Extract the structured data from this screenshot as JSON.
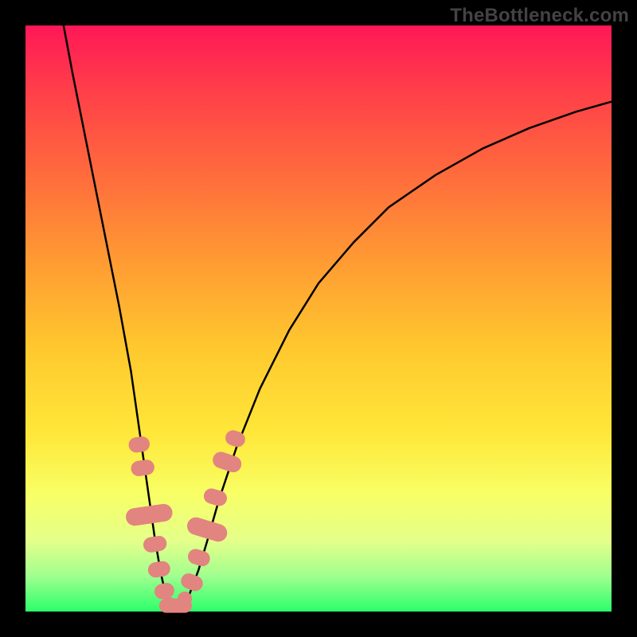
{
  "watermark": "TheBottleneck.com",
  "colors": {
    "curve_stroke": "#000000",
    "marker_fill": "#e2847f",
    "marker_stroke": "#e2847f"
  },
  "chart_data": {
    "type": "line",
    "title": "",
    "xlabel": "",
    "ylabel": "",
    "xlim": [
      0,
      100
    ],
    "ylim": [
      0,
      100
    ],
    "curve_points": [
      {
        "x": 6.5,
        "y": 100
      },
      {
        "x": 8.0,
        "y": 92
      },
      {
        "x": 10.0,
        "y": 82
      },
      {
        "x": 12.0,
        "y": 72
      },
      {
        "x": 14.0,
        "y": 62
      },
      {
        "x": 16.0,
        "y": 52
      },
      {
        "x": 18.0,
        "y": 41
      },
      {
        "x": 19.0,
        "y": 34
      },
      {
        "x": 20.0,
        "y": 27
      },
      {
        "x": 21.0,
        "y": 20
      },
      {
        "x": 22.0,
        "y": 13
      },
      {
        "x": 23.0,
        "y": 7
      },
      {
        "x": 24.0,
        "y": 2.5
      },
      {
        "x": 25.0,
        "y": 0.7
      },
      {
        "x": 26.5,
        "y": 0.7
      },
      {
        "x": 28.0,
        "y": 3
      },
      {
        "x": 29.5,
        "y": 7
      },
      {
        "x": 31.0,
        "y": 12
      },
      {
        "x": 33.0,
        "y": 19
      },
      {
        "x": 36.0,
        "y": 28
      },
      {
        "x": 40.0,
        "y": 38
      },
      {
        "x": 45.0,
        "y": 48
      },
      {
        "x": 50.0,
        "y": 56
      },
      {
        "x": 56.0,
        "y": 63
      },
      {
        "x": 62.0,
        "y": 69
      },
      {
        "x": 70.0,
        "y": 74.5
      },
      {
        "x": 78.0,
        "y": 79
      },
      {
        "x": 86.0,
        "y": 82.5
      },
      {
        "x": 94.0,
        "y": 85.3
      },
      {
        "x": 100.0,
        "y": 87
      }
    ],
    "markers": [
      {
        "x": 19.4,
        "y": 28.5,
        "w": 2.6,
        "h": 3.6
      },
      {
        "x": 20.0,
        "y": 24.5,
        "w": 2.6,
        "h": 4.0
      },
      {
        "x": 21.1,
        "y": 16.5,
        "w": 3.0,
        "h": 8.0
      },
      {
        "x": 22.1,
        "y": 11.5,
        "w": 2.6,
        "h": 4.0
      },
      {
        "x": 22.8,
        "y": 7.2,
        "w": 2.6,
        "h": 3.8
      },
      {
        "x": 23.7,
        "y": 3.5,
        "w": 2.6,
        "h": 3.4
      },
      {
        "x": 24.5,
        "y": 1.2,
        "w": 2.6,
        "h": 2.4
      },
      {
        "x": 25.6,
        "y": 1.0,
        "w": 5.6,
        "h": 2.4
      },
      {
        "x": 27.2,
        "y": 2.2,
        "w": 2.4,
        "h": 2.4
      },
      {
        "x": 28.4,
        "y": 5.0,
        "w": 2.6,
        "h": 3.8
      },
      {
        "x": 29.6,
        "y": 9.2,
        "w": 2.6,
        "h": 3.8
      },
      {
        "x": 31.0,
        "y": 14.0,
        "w": 3.0,
        "h": 7.0
      },
      {
        "x": 32.4,
        "y": 19.5,
        "w": 2.6,
        "h": 4.0
      },
      {
        "x": 34.4,
        "y": 25.5,
        "w": 2.8,
        "h": 5.0
      },
      {
        "x": 35.8,
        "y": 29.5,
        "w": 2.6,
        "h": 3.4
      }
    ]
  }
}
